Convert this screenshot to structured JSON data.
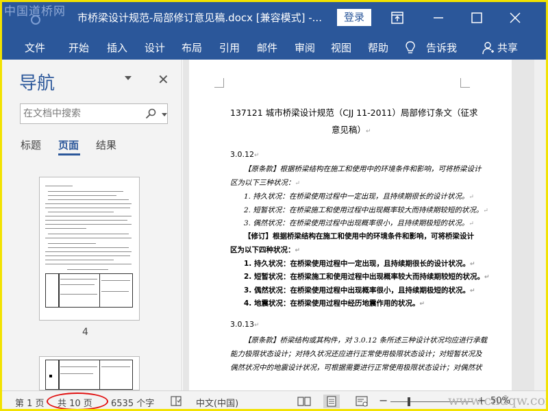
{
  "watermark_top": "中国道桥网",
  "watermark_bottom": "www.cndqw.com",
  "titlebar": {
    "doc_title": "市桥梁设计规范-局部修订意见稿.docx [兼容模式]  -...",
    "login_label": "登录"
  },
  "ribbon": {
    "tabs": [
      "文件",
      "开始",
      "插入",
      "设计",
      "布局",
      "引用",
      "邮件",
      "审阅",
      "视图",
      "帮助"
    ],
    "tell_me": "告诉我",
    "share": "共享"
  },
  "nav": {
    "title": "导航",
    "search_placeholder": "在文档中搜索",
    "tabs": [
      "标题",
      "页面",
      "结果"
    ],
    "active_tab": "页面",
    "page_number": "4"
  },
  "document": {
    "title_line1": "137121 城市桥梁设计规范（CJJ 11-2011）局部修订条文（征求",
    "title_line2": "意见稿）",
    "sec1": "3.0.12",
    "orig1_a": "【原条款】根据桥梁结构在施工和使用中的环境条件和影响，可将桥梁设计",
    "orig1_b": "区为以下三种状况：",
    "orig1_item1": "1.  持久状况：在桥梁使用过程中一定出现，且持续期很长的设计状况。",
    "orig1_item2": "2.  短暂状况：在桥梁施工和使用过程中出现概率较大而持续期较短的状况。",
    "orig1_item3": "3.  偶然状况：在桥梁使用过程中出现概率很小，且持续期极短的状况。",
    "rev1_a": "【修订】根据桥梁结构在施工和使用中的环境条件和影响，可将桥梁设计",
    "rev1_b": "区为以下四种状况：",
    "rev1_item1": "1.  持久状况：在桥梁使用过程中一定出现，且持续期很长的设计状况。",
    "rev1_item2": "2.  短暂状况：在桥梁施工和使用过程中出现概率较大而持续期较短的状况。",
    "rev1_item3": "3.  偶然状况：在桥梁使用过程中出现概率很小，且持续期极短的状况。",
    "rev1_item4": "4.  地震状况：在桥梁使用过程中经历地震作用的状况。",
    "sec2": "3.0.13",
    "orig2_a": "【原条款】桥梁结构或其构件，对 3.0.12 条所述三种设计状况均应进行承载",
    "orig2_b": "能力极限状态设计；对持久状况还应进行正常使用极限状态设计；对短暂状况及",
    "orig2_c": "偶然状况中的地震设计状况，可根据需要进行正常使用极限状态设计；对偶然状"
  },
  "status": {
    "page": "第 1 页",
    "total_pages": "共 10 页",
    "word_count": "6535 个字",
    "language": "中文(中国)",
    "zoom": "50%"
  },
  "colors": {
    "ribbon_blue": "#2b579a",
    "highlight_red": "#e01010",
    "frame_yellow": "#f2e200"
  }
}
